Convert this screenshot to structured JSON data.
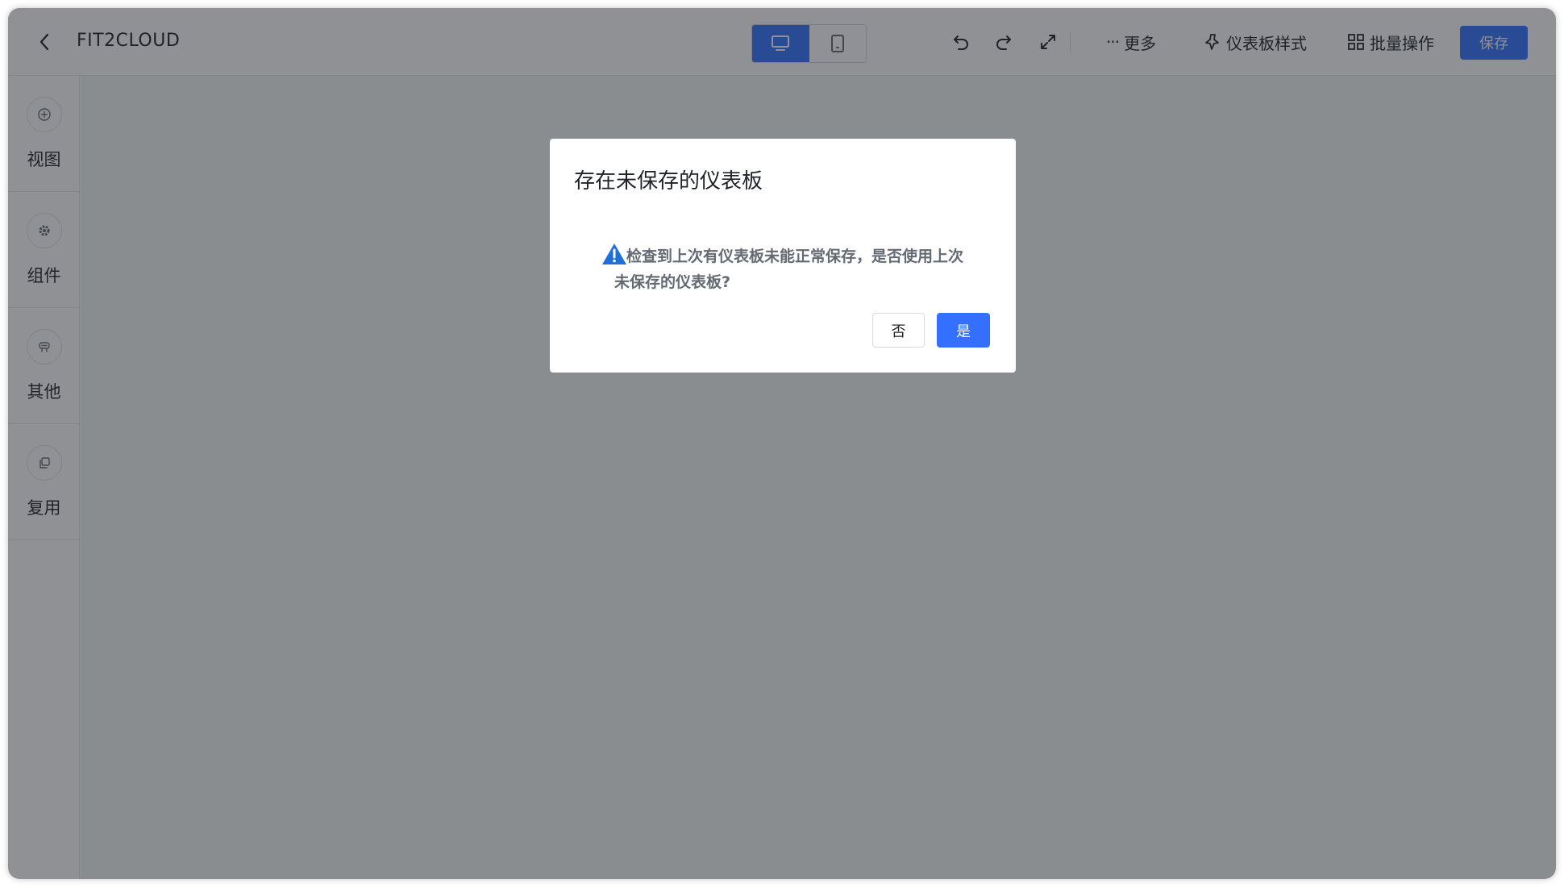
{
  "header": {
    "title": "FIT2CLOUD",
    "more_label": "更多",
    "style_label": "仪表板样式",
    "batch_label": "批量操作",
    "save_label": "保存"
  },
  "sidebar": {
    "items": [
      {
        "label": "视图",
        "icon": "plus-circle-icon"
      },
      {
        "label": "组件",
        "icon": "gear-icon"
      },
      {
        "label": "其他",
        "icon": "other-icon"
      },
      {
        "label": "复用",
        "icon": "copy-icon"
      }
    ]
  },
  "dialog": {
    "title": "存在未保存的仪表板",
    "message_line1": "检查到上次有仪表板未能正常保存，是否使用上次",
    "message_line2": "未保存的仪表板?",
    "no_label": "否",
    "yes_label": "是"
  },
  "colors": {
    "accent": "#3370ff",
    "warning": "#1e6fd9",
    "overlay": "rgba(31,35,41,0.5)"
  }
}
